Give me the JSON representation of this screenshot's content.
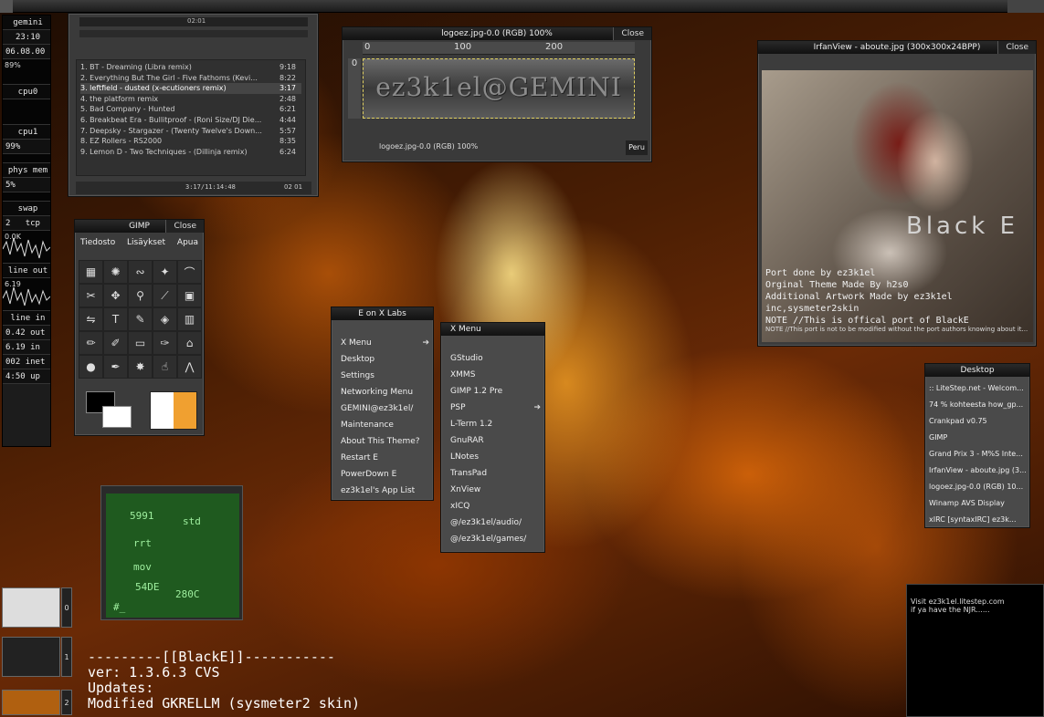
{
  "gkrellm": {
    "host": "gemini",
    "time": "23:10",
    "date": "06.08.00",
    "cpu_load": "89%",
    "cpu0": "cpu0",
    "cpu1": "cpu1",
    "cpu1_val": "99%",
    "phys_mem": "phys mem",
    "mem_val": "5%",
    "swap": "swap",
    "tcp": "tcp",
    "tcp_val": "2",
    "net_top": "0.0K",
    "line_out": "line out",
    "out_val": "6.19",
    "line_in": "line in",
    "out": "out",
    "out_num": "0.42",
    "in": "in",
    "in_num": "6.19",
    "inet": "inet",
    "inet_num": "002",
    "up": "up",
    "up_num": "4:50"
  },
  "xmms": {
    "time_top": "02:01",
    "time_bottom": "3:17/11:14:48",
    "time_right": "02 01",
    "playlist": [
      {
        "title": "1. BT - Dreaming (Libra remix)",
        "len": "9:18"
      },
      {
        "title": "2. Everything But The Girl - Five Fathoms (Kevi...",
        "len": "8:22"
      },
      {
        "title": "3. leftfield - dusted (x-ecutioners remix)",
        "len": "3:17"
      },
      {
        "title": "4. the platform remix",
        "len": "2:48"
      },
      {
        "title": "5. Bad Company - Hunted",
        "len": "6:21"
      },
      {
        "title": "6. Breakbeat Era - Bullitproof - (Roni Size/DJ Die...",
        "len": "4:44"
      },
      {
        "title": "7. Deepsky - Stargazer - (Twenty Twelve's Down...",
        "len": "5:57"
      },
      {
        "title": "8. EZ Rollers - RS2000",
        "len": "8:35"
      },
      {
        "title": "9. Lemon D - Two Techniques - (Dillinja remix)",
        "len": "6:24"
      }
    ]
  },
  "gimp_image": {
    "title": "logoez.jpg-0.0 (RGB) 100%",
    "close": "Close",
    "logo_text": "ez3k1el@GEMINI",
    "ruler_0": "0",
    "ruler_100": "100",
    "ruler_200": "200",
    "vruler": "0",
    "status": "logoez.jpg-0.0 (RGB) 100%",
    "zoom_btn": "Peru"
  },
  "gimp_toolbox": {
    "title": "GIMP",
    "close": "Close",
    "menu": [
      "Tiedosto",
      "Lisäykset",
      "Apua"
    ]
  },
  "irfanview": {
    "title": "IrfanView - aboute.jpg (300x300x24BPP)",
    "close": "Close",
    "big_text": "Black E",
    "credits": [
      "Port done by ez3k1el",
      "Orginal Theme Made By h2s0",
      "Additional Artwork Made by ez3k1el inc,sysmeter2skin",
      "NOTE //This is offical port of BlackE"
    ],
    "note": "NOTE //This port is not to be modified without the port authors knowing about it..."
  },
  "menu1": {
    "title": "E on X Labs",
    "items": [
      "X Menu",
      "Desktop",
      "Settings",
      "Networking Menu",
      "GEMINI@ez3k1el/",
      "Maintenance",
      "About This Theme?",
      "Restart E",
      "PowerDown E",
      "ez3k1el's App List"
    ]
  },
  "menu2": {
    "title": "X Menu",
    "items": [
      "GStudio",
      "XMMS",
      "GIMP 1.2 Pre",
      "PSP",
      "L-Term 1.2",
      "GnuRAR",
      "LNotes",
      "TransPad",
      "XnView",
      "xICQ",
      "@/ez3k1el/audio/",
      "@/ez3k1el/games/"
    ]
  },
  "desktop_list": {
    "title": "Desktop",
    "items": [
      ":: LiteStep.net - Welcom...",
      "74 % kohteesta how_gp...",
      "Crankpad v0.75",
      "GIMP",
      "Grand Prix 3 - M%S Inte...",
      "IrfanView - aboute.jpg (3...",
      "logoez.jpg-0.0 (RGB) 10...",
      "Winamp AVS Display",
      "xIRC [syntaxIRC] ez3k..."
    ]
  },
  "pager": {
    "d0": "0",
    "d1": "1",
    "d2": "2"
  },
  "terminal": {
    "lines": [
      "5991",
      "std",
      "rrt",
      "mov",
      "54DE",
      "280C",
      "#_"
    ]
  },
  "bottom_text": {
    "line1": "---------[[BlackE]]-----------",
    "line2": "ver: 1.3.6.3 CVS",
    "line3": "Updates:",
    "line4": "Modified GKRELLM (sysmeter2 skin)"
  },
  "irc": {
    "line1": "Visit ez3k1el.litestep.com",
    "line2": "if ya have the NJR......"
  }
}
